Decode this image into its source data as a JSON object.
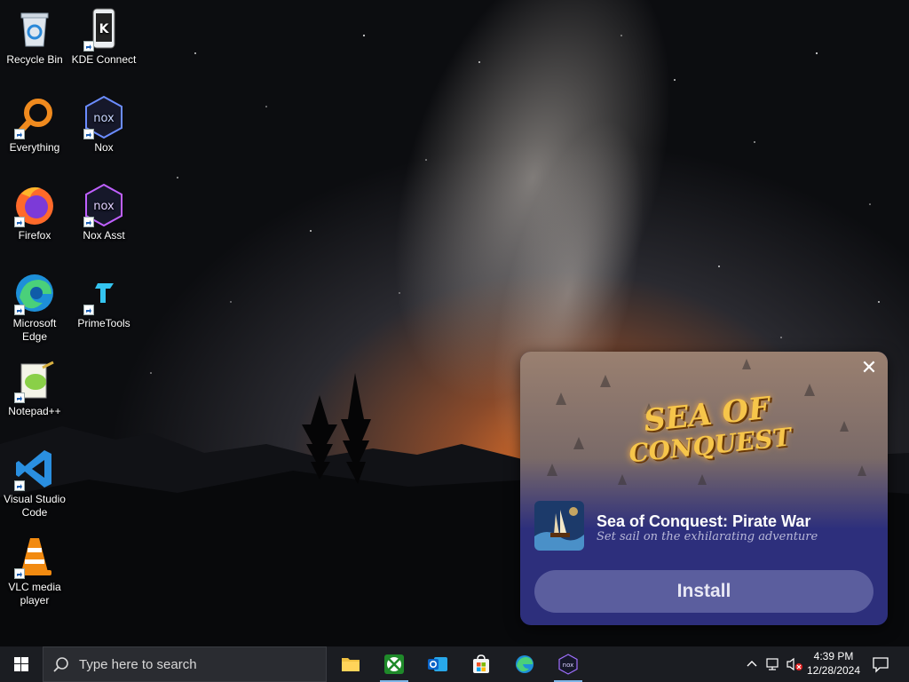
{
  "desktop": {
    "icons": [
      {
        "label": "Recycle Bin",
        "icon": "recycle-bin-icon"
      },
      {
        "label": "KDE Connect",
        "icon": "kde-connect-icon"
      },
      {
        "label": "Everything",
        "icon": "everything-search-icon"
      },
      {
        "label": "Nox",
        "icon": "nox-icon"
      },
      {
        "label": "Firefox",
        "icon": "firefox-icon"
      },
      {
        "label": "Nox Asst",
        "icon": "nox-assistant-icon"
      },
      {
        "label": "Microsoft Edge",
        "icon": "edge-icon"
      },
      {
        "label": "PrimeTools",
        "icon": "primetools-icon"
      },
      {
        "label": "Notepad++",
        "icon": "notepad-plus-plus-icon"
      },
      {
        "label": "Visual Studio Code",
        "icon": "vscode-icon"
      },
      {
        "label": "VLC media player",
        "icon": "vlc-icon"
      }
    ]
  },
  "popup": {
    "logo_line1": "SEA OF",
    "logo_line2": "CONQUEST",
    "game_title": "Sea of Conquest: Pirate War",
    "game_subtitle": "Set sail on the exhilarating adventure",
    "install_label": "Install",
    "close_glyph": "✕",
    "background_color": "#2d2f7c",
    "button_color": "#5b5e9e"
  },
  "taskbar": {
    "search_placeholder": "Type here to search",
    "pinned_apps": [
      "file-explorer-icon",
      "xbox-icon",
      "outlook-icon",
      "microsoft-store-icon",
      "edge-icon",
      "nox-icon"
    ],
    "clock_time": "4:39 PM",
    "clock_date": "12/28/2024"
  }
}
